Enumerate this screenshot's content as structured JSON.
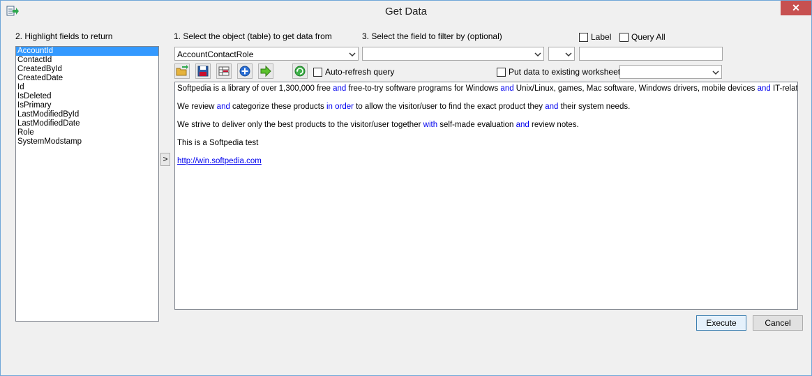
{
  "window": {
    "title": "Get Data"
  },
  "fields": {
    "label": "2. Highlight fields to return",
    "items": [
      "AccountId",
      "ContactId",
      "CreatedById",
      "CreatedDate",
      "Id",
      "IsDeleted",
      "IsPrimary",
      "LastModifiedById",
      "LastModifiedDate",
      "Role",
      "SystemModstamp"
    ],
    "selected": "AccountId"
  },
  "object": {
    "label": "1. Select the object (table) to get data from",
    "value": "AccountContactRole"
  },
  "filter": {
    "label": "3. Select the field to filter by (optional)",
    "field_value": "",
    "operator_value": "",
    "value": ""
  },
  "options": {
    "label_checkbox": "Label",
    "query_all": "Query All",
    "auto_refresh": "Auto-refresh query",
    "put_data": "Put data to existing worksheet",
    "worksheet_value": ""
  },
  "toolbar": {
    "move_right": ">"
  },
  "query_text": {
    "line1_a": "Softpedia is a library of over 1,300,000 free ",
    "kw_and": "and",
    "line1_b": " free-to-try software programs for Windows ",
    "line1_c": " Unix/Linux, games, Mac software, Windows drivers, mobile devices ",
    "line1_d": " IT-related articles.",
    "line2_a": "We review ",
    "line2_b": " categorize these products ",
    "kw_in_order": "in order",
    "line2_c": " to allow the visitor/user to find the exact product they ",
    "line2_d": " their system needs.",
    "line3_a": "We strive to deliver only the best products to the visitor/user together ",
    "kw_with": "with",
    "line3_b": " self-made evaluation ",
    "line3_c": " review notes.",
    "line4": "This is a Softpedia test",
    "link": "http://win.softpedia.com"
  },
  "buttons": {
    "execute": "Execute",
    "cancel": "Cancel",
    "close": "✕"
  },
  "colors": {
    "selection": "#3399ff",
    "keyword": "#0000ee",
    "close": "#c75050"
  }
}
